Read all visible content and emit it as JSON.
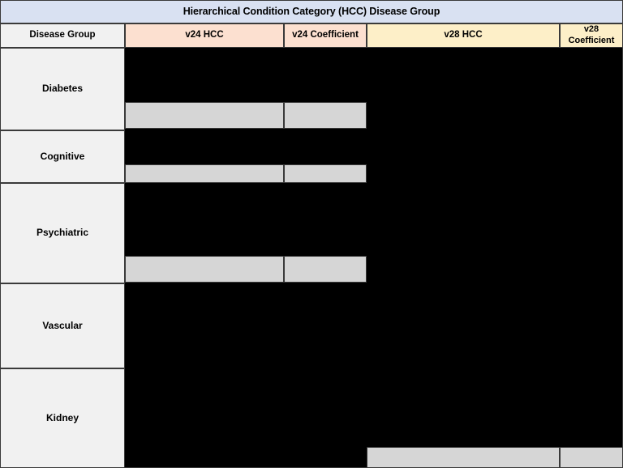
{
  "table": {
    "title": "Hierarchical Condition Category (HCC) Disease Group",
    "columns": {
      "disease_group": "Disease Group",
      "v24_hcc": "v24 HCC",
      "v24_coefficient": "v24 Coefficient",
      "v28_hcc": "v28 HCC",
      "v28_coefficient_line1": "v28",
      "v28_coefficient_line2": "Coefficient"
    },
    "rows": [
      {
        "disease_group": "Diabetes"
      },
      {
        "disease_group": "Cognitive"
      },
      {
        "disease_group": "Psychiatric"
      },
      {
        "disease_group": "Vascular"
      },
      {
        "disease_group": "Kidney"
      }
    ]
  },
  "colors": {
    "title_band": "#D9E1F2",
    "v24_header": "#FCE0D0",
    "v28_header": "#FDEFC8",
    "disease_group_cell": "#F1F1F1",
    "redaction": "#000000",
    "partial_bar": "#D6D6D6",
    "border": "#3A3A3A"
  }
}
